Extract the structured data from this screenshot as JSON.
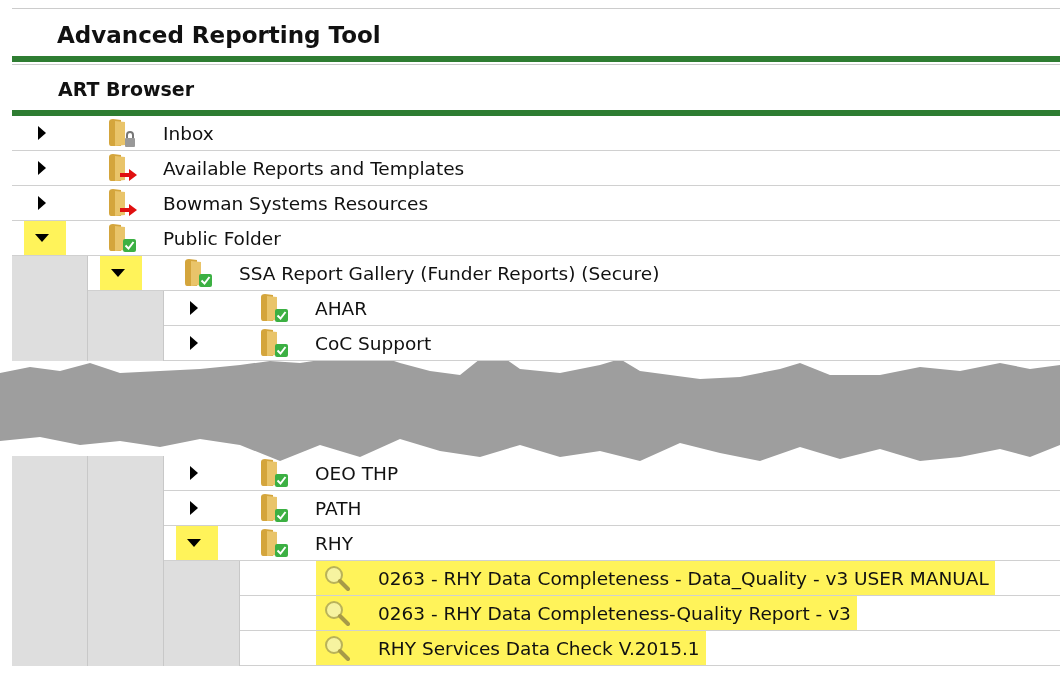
{
  "app_title": "Advanced Reporting Tool",
  "panel_title": "ART Browser",
  "tree": [
    {
      "kind": "folder",
      "label": "Inbox",
      "locked": true,
      "linked": false,
      "shared": false,
      "expanded": false
    },
    {
      "kind": "folder",
      "label": "Available Reports and Templates",
      "locked": false,
      "linked": true,
      "shared": false,
      "expanded": false
    },
    {
      "kind": "folder",
      "label": "Bowman Systems Resources",
      "locked": false,
      "linked": true,
      "shared": false,
      "expanded": false
    },
    {
      "kind": "folder",
      "label": "Public Folder",
      "locked": false,
      "linked": false,
      "shared": true,
      "expanded": true,
      "children": [
        {
          "kind": "folder",
          "label": "SSA Report Gallery (Funder Reports) (Secure)",
          "locked": false,
          "linked": false,
          "shared": true,
          "expanded": true,
          "children": [
            {
              "kind": "folder",
              "label": "AHAR",
              "locked": false,
              "linked": false,
              "shared": true,
              "expanded": false
            },
            {
              "kind": "folder",
              "label": "CoC Support",
              "locked": false,
              "linked": false,
              "shared": true,
              "expanded": false
            },
            {
              "kind": "torn"
            },
            {
              "kind": "folder",
              "label": "OEO THP",
              "locked": false,
              "linked": false,
              "shared": true,
              "expanded": false
            },
            {
              "kind": "folder",
              "label": "PATH",
              "locked": false,
              "linked": false,
              "shared": true,
              "expanded": false
            },
            {
              "kind": "folder",
              "label": "RHY",
              "locked": false,
              "linked": false,
              "shared": true,
              "expanded": true,
              "children": [
                {
                  "kind": "report",
                  "label": "0263 - RHY Data Completeness - Data_Quality - v3 USER MANUAL",
                  "highlighted": true
                },
                {
                  "kind": "report",
                  "label": "0263 - RHY Data Completeness-Quality Report - v3",
                  "highlighted": true
                },
                {
                  "kind": "report",
                  "label": "RHY Services Data Check V.2015.1",
                  "highlighted": true
                }
              ]
            }
          ]
        }
      ]
    }
  ]
}
